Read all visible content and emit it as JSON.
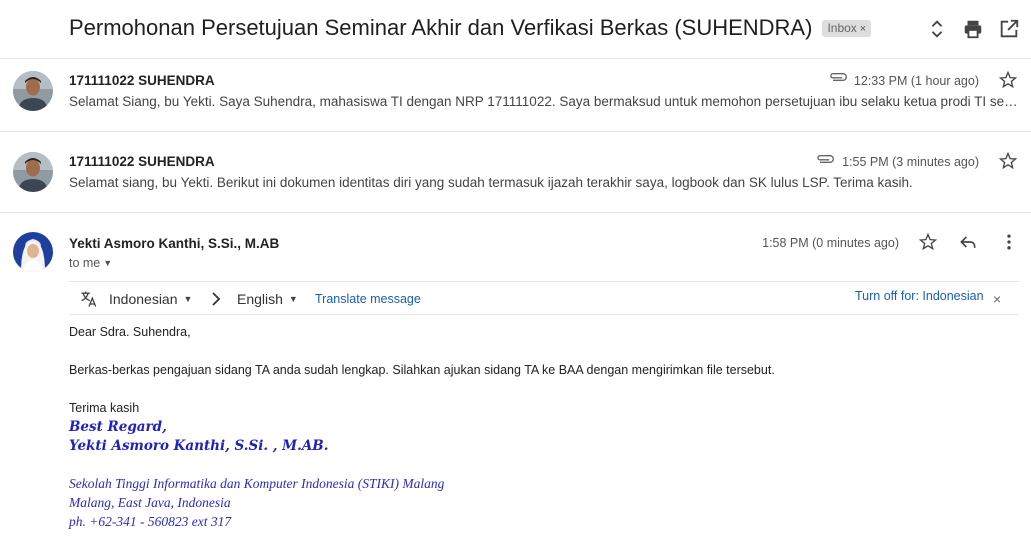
{
  "subject": {
    "title": "Permohonan Persetujuan Seminar Akhir dan Verfikasi Berkas (SUHENDRA)",
    "label": "Inbox",
    "label_close": "×"
  },
  "toolbar_icons": [
    "expand-collapse-icon",
    "print-icon",
    "open-in-new-window-icon"
  ],
  "messages": [
    {
      "sender": "171111022 SUHENDRA",
      "time": "12:33 PM (1 hour ago)",
      "snippet": "Selamat Siang, bu Yekti. Saya Suhendra, mahasiswa TI dengan NRP 171111022. Saya bermaksud untuk memohon persetujuan ibu selaku ketua prodi TI sekaligus dosen pembimbing saya",
      "has_attachment": true
    },
    {
      "sender": "171111022 SUHENDRA",
      "time": "1:55 PM (3 minutes ago)",
      "snippet": "Selamat siang, bu Yekti. Berikut ini dokumen identitas diri yang sudah termasuk ijazah terakhir saya, logbook dan SK lulus LSP. Terima kasih.",
      "has_attachment": true
    },
    {
      "sender": "Yekti Asmoro Kanthi, S.Si., M.AB",
      "time": "1:58 PM (0 minutes ago)",
      "recipient": "to me"
    }
  ],
  "translate": {
    "source_lang": "Indonesian",
    "target_lang": "English",
    "translate_link": "Translate message",
    "turn_off": "Turn off for: Indonesian",
    "close": "×"
  },
  "body": {
    "greeting": "Dear Sdra. Suhendra,",
    "paragraph": "Berkas-berkas pengajuan sidang TA anda sudah lengkap. Silahkan ajukan sidang TA ke BAA dengan mengirimkan file tersebut.",
    "closing": "Terima kasih",
    "sig_line1": "Best Regard,",
    "sig_line2": "Yekti Asmoro Kanthi, S.Si. , M.AB.",
    "sig_org": "Sekolah Tinggi Informatika dan Komputer Indonesia (STIKI) Malang",
    "sig_city": "Malang, East Java, Indonesia",
    "sig_phone": "ph. +62-341 - 560823 ext 317"
  }
}
